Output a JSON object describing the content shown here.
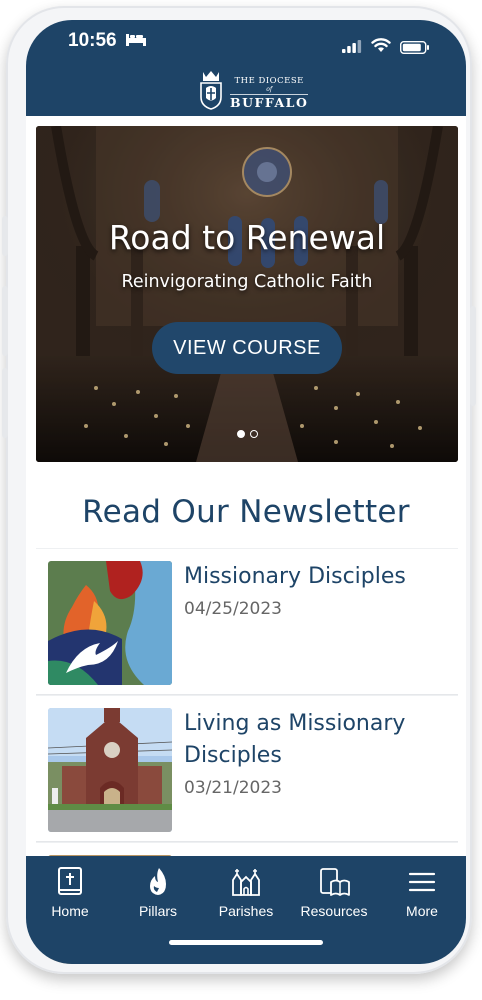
{
  "status_bar": {
    "time": "10:56"
  },
  "header": {
    "logo_line1": "THE DIOCESE",
    "logo_line2": "of",
    "logo_line3": "BUFFALO"
  },
  "hero": {
    "title": "Road to Renewal",
    "subtitle": "Reinvigorating Catholic Faith",
    "button_label": "VIEW COURSE",
    "slide_count": 2,
    "active_slide": 1
  },
  "newsletter": {
    "heading": "Read Our Newsletter",
    "items": [
      {
        "title": "Missionary Disciples",
        "date": "04/25/2023"
      },
      {
        "title": "Living as Missionary Disciples",
        "date": "03/21/2023"
      },
      {
        "title": "",
        "date": ""
      }
    ]
  },
  "tabbar": {
    "items": [
      {
        "label": "Home",
        "icon": "bible-icon"
      },
      {
        "label": "Pillars",
        "icon": "flame-icon"
      },
      {
        "label": "Parishes",
        "icon": "church-icon"
      },
      {
        "label": "Resources",
        "icon": "book-resources-icon"
      },
      {
        "label": "More",
        "icon": "hamburger-menu-icon"
      }
    ]
  },
  "colors": {
    "brand_navy": "#1e4467",
    "button_navy": "#21476b",
    "text_gray": "#666666"
  }
}
